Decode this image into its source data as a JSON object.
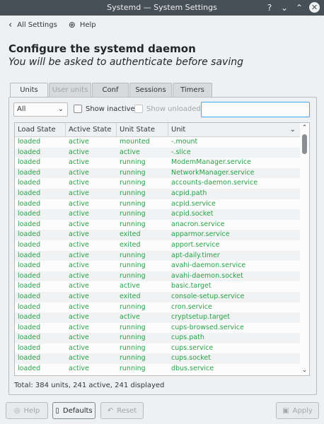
{
  "window": {
    "title": "Systemd — System Settings",
    "controls": [
      "?",
      "⌄",
      "⌃",
      "✕"
    ]
  },
  "nav": {
    "back_label": "All Settings",
    "help_label": "Help"
  },
  "header": {
    "title": "Configure the systemd daemon",
    "subtitle": "You will be asked to authenticate before saving"
  },
  "tabs": [
    {
      "label": "Units",
      "state": "active"
    },
    {
      "label": "User units",
      "state": "disabled"
    },
    {
      "label": "Conf",
      "state": "normal"
    },
    {
      "label": "Sessions",
      "state": "normal"
    },
    {
      "label": "Timers",
      "state": "normal"
    }
  ],
  "filters": {
    "type_select": "All",
    "show_inactive": "Show inactive",
    "show_unloaded": "Show unloaded",
    "search_value": ""
  },
  "table": {
    "columns": [
      "Load State",
      "Active State",
      "Unit State",
      "Unit"
    ],
    "rows": [
      [
        "loaded",
        "active",
        "mounted",
        "-.mount"
      ],
      [
        "loaded",
        "active",
        "active",
        "-.slice"
      ],
      [
        "loaded",
        "active",
        "running",
        "ModemManager.service"
      ],
      [
        "loaded",
        "active",
        "running",
        "NetworkManager.service"
      ],
      [
        "loaded",
        "active",
        "running",
        "accounts-daemon.service"
      ],
      [
        "loaded",
        "active",
        "running",
        "acpid.path"
      ],
      [
        "loaded",
        "active",
        "running",
        "acpid.service"
      ],
      [
        "loaded",
        "active",
        "running",
        "acpid.socket"
      ],
      [
        "loaded",
        "active",
        "running",
        "anacron.service"
      ],
      [
        "loaded",
        "active",
        "exited",
        "apparmor.service"
      ],
      [
        "loaded",
        "active",
        "exited",
        "apport.service"
      ],
      [
        "loaded",
        "active",
        "running",
        "apt-daily.timer"
      ],
      [
        "loaded",
        "active",
        "running",
        "avahi-daemon.service"
      ],
      [
        "loaded",
        "active",
        "running",
        "avahi-daemon.socket"
      ],
      [
        "loaded",
        "active",
        "active",
        "basic.target"
      ],
      [
        "loaded",
        "active",
        "exited",
        "console-setup.service"
      ],
      [
        "loaded",
        "active",
        "running",
        "cron.service"
      ],
      [
        "loaded",
        "active",
        "active",
        "cryptsetup.target"
      ],
      [
        "loaded",
        "active",
        "running",
        "cups-browsed.service"
      ],
      [
        "loaded",
        "active",
        "running",
        "cups.path"
      ],
      [
        "loaded",
        "active",
        "running",
        "cups.service"
      ],
      [
        "loaded",
        "active",
        "running",
        "cups.socket"
      ],
      [
        "loaded",
        "active",
        "running",
        "dbus.service"
      ]
    ]
  },
  "status": {
    "total": "Total: 384 units, 241 active, 241 displayed"
  },
  "footer": {
    "help_label": "Help",
    "defaults_label": "Defaults",
    "reset_label": "Reset",
    "apply_label": "Apply"
  },
  "colors": {
    "active_row_text": "#26a347",
    "focus_border": "#3daee9",
    "titlebar": "#475057"
  }
}
